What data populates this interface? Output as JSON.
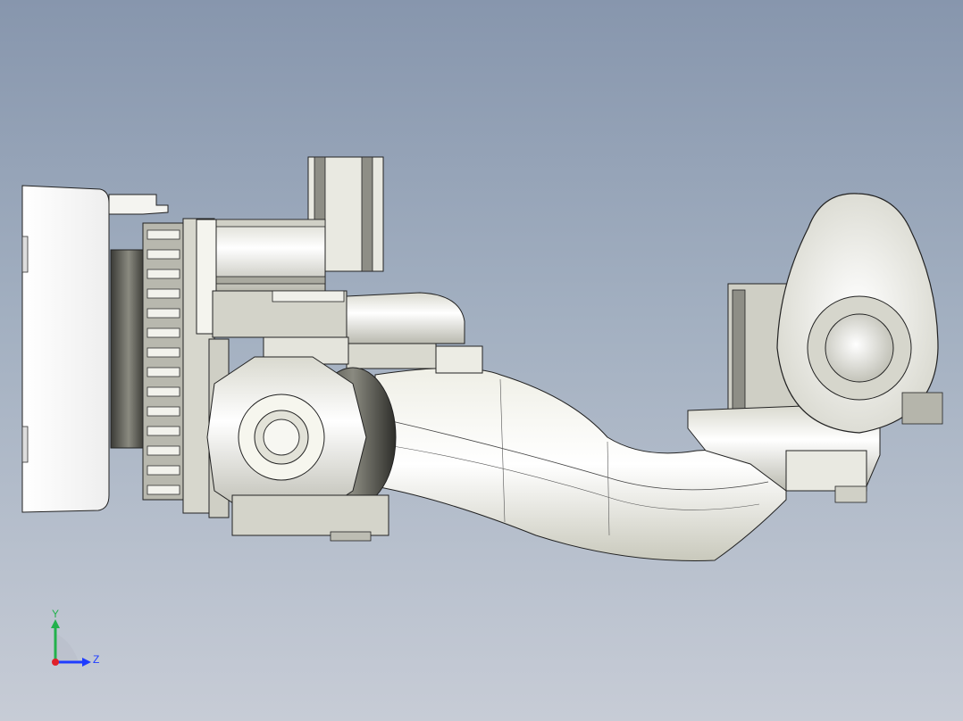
{
  "viewport": {
    "background_top": "#8796ad",
    "background_bottom": "#c7ccd6"
  },
  "triad": {
    "y_label": "Y",
    "z_label": "Z",
    "y_color": "#22b14c",
    "z_color": "#1f3cff",
    "x_color": "#e0202a"
  }
}
